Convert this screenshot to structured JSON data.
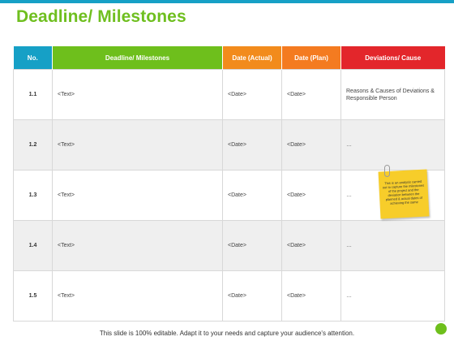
{
  "slide": {
    "title": "Deadline/ Milestones",
    "footer": "This slide is 100% editable. Adapt it to your needs and capture your audience's attention.",
    "accent_colors": {
      "blue": "#16a0c6",
      "green": "#6ebf1c",
      "orange": "#f28b1c",
      "orange2": "#f47b20",
      "red": "#e3262b",
      "note": "#f7cd2a"
    }
  },
  "table": {
    "headers": [
      "No.",
      "Deadline/ Milestones",
      "Date (Actual)",
      "Date (Plan)",
      "Deviations/ Cause"
    ],
    "rows": [
      {
        "no": "1.1",
        "milestone": "<Text>",
        "actual": "<Date>",
        "plan": "<Date>",
        "deviation": "Reasons & Causes of Deviations & Responsible Person"
      },
      {
        "no": "1.2",
        "milestone": "<Text>",
        "actual": "<Date>",
        "plan": "<Date>",
        "deviation": "…"
      },
      {
        "no": "1.3",
        "milestone": "<Text>",
        "actual": "<Date>",
        "plan": "<Date>",
        "deviation": "…"
      },
      {
        "no": "1.4",
        "milestone": "<Text>",
        "actual": "<Date>",
        "plan": "<Date>",
        "deviation": "…"
      },
      {
        "no": "1.5",
        "milestone": "<Text>",
        "actual": "<Date>",
        "plan": "<Date>",
        "deviation": "…"
      }
    ]
  },
  "sticky_note": {
    "text": "This is an analysis carried out to capture the milestones of the project and the deviation between the planned & actual dates of achieving the same",
    "icon": "paperclip-icon"
  }
}
